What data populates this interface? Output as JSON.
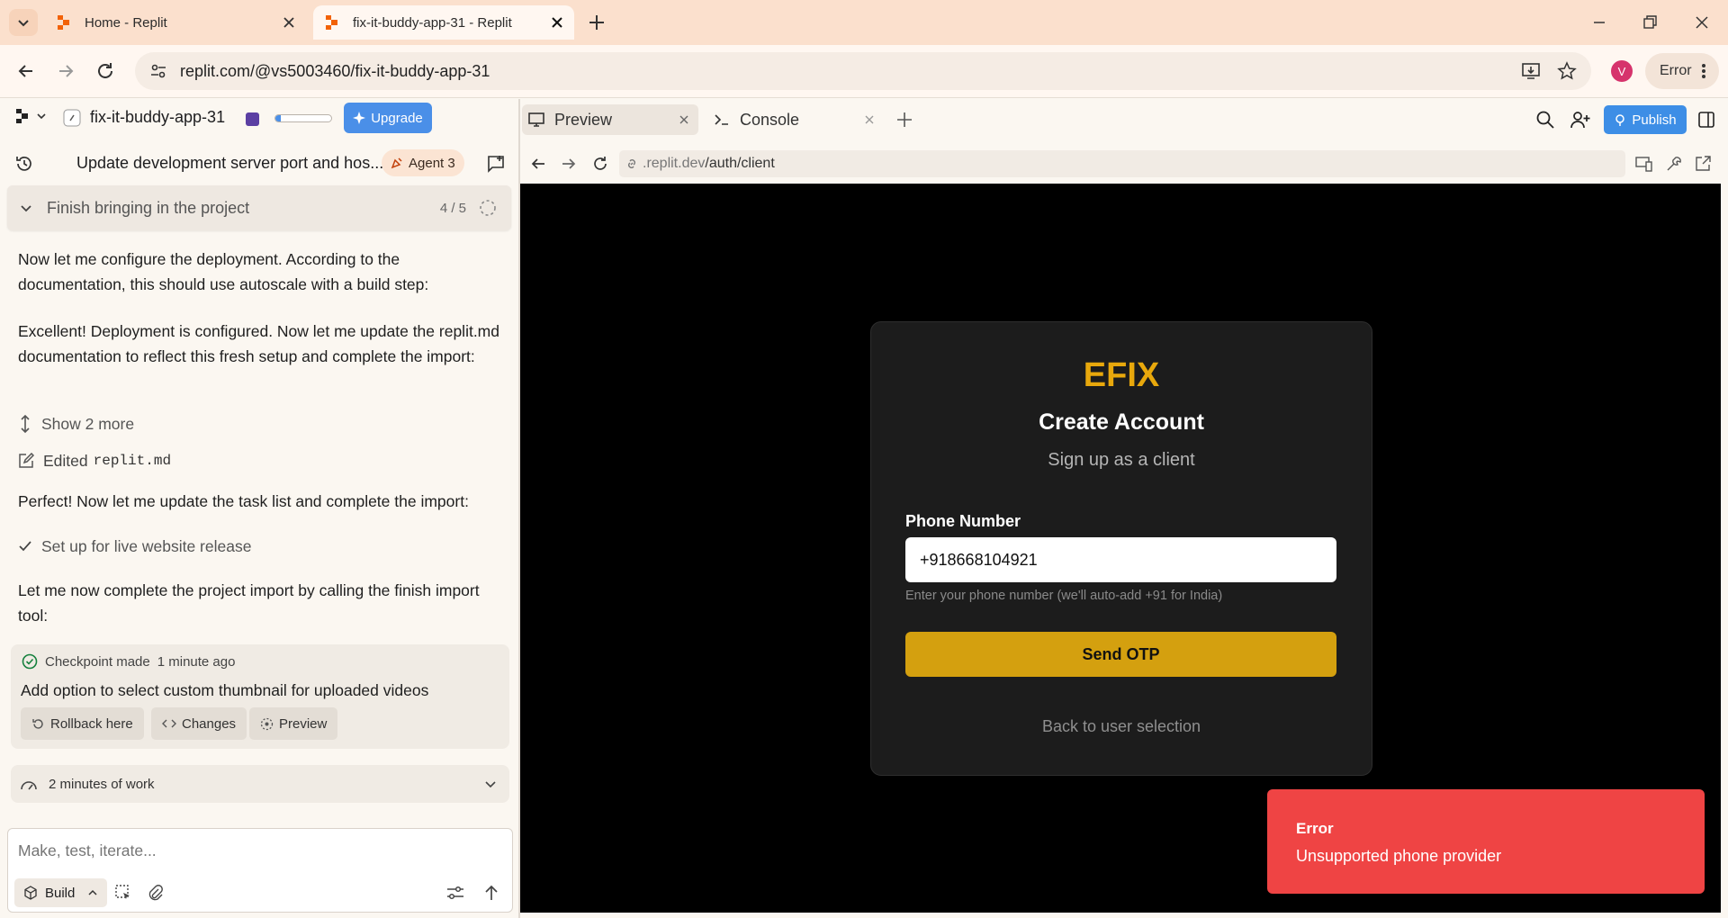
{
  "browser": {
    "tabs": [
      {
        "title": "Home - Replit"
      },
      {
        "title": "fix-it-buddy-app-31 - Replit"
      }
    ],
    "url": "replit.com/@vs5003460/fix-it-buddy-app-31",
    "profile_initial": "V",
    "error_label": "Error"
  },
  "app": {
    "project_name": "fix-it-buddy-app-31",
    "upgrade_label": "Upgrade",
    "setup_progress": 0.1,
    "pane_tabs": [
      {
        "label": "Preview"
      },
      {
        "label": "Console"
      }
    ],
    "publish_label": "Publish"
  },
  "chat": {
    "thread_title": "Update development server port and hos...",
    "agent_badge": "Agent 3",
    "task": {
      "title": "Finish bringing in the project",
      "progress": "4 / 5"
    },
    "messages": [
      "Now let me configure the deployment. According to the documentation, this should use autoscale with a build step:",
      "Excellent! Deployment is configured. Now let me update the replit.md documentation to reflect this fresh setup and complete the import:",
      "Perfect! Now let me update the task list and complete the import:",
      "Let me now complete the project import by calling the finish import tool:"
    ],
    "show_more": "Show 2 more",
    "edited_prefix": "Edited",
    "edited_file": "replit.md",
    "task_done": "Set up for live website release",
    "checkpoint": {
      "made": "Checkpoint made",
      "time": "1 minute ago",
      "description": "Add option to select custom thumbnail for uploaded videos",
      "buttons": [
        "Rollback here",
        "Changes",
        "Preview"
      ]
    },
    "work_summary": "2 minutes of work",
    "composer_placeholder": "Make, test, iterate...",
    "mode": "Build"
  },
  "preview": {
    "url_domain": ".replit.dev",
    "url_path": "/auth/client",
    "brand": "EFIX",
    "heading": "Create Account",
    "subheading": "Sign up as a client",
    "phone_label": "Phone Number",
    "phone_value": "+918668104921",
    "phone_hint": "Enter your phone number (we'll auto-add +91 for India)",
    "send_label": "Send OTP",
    "back_link": "Back to user selection"
  },
  "toast": {
    "title": "Error",
    "message": "Unsupported phone provider"
  },
  "colors": {
    "brand_gold": "#e8a80c",
    "otp_button": "#d4a00f",
    "toast_red": "#ef4444",
    "accent_blue": "#4a8fe8"
  }
}
